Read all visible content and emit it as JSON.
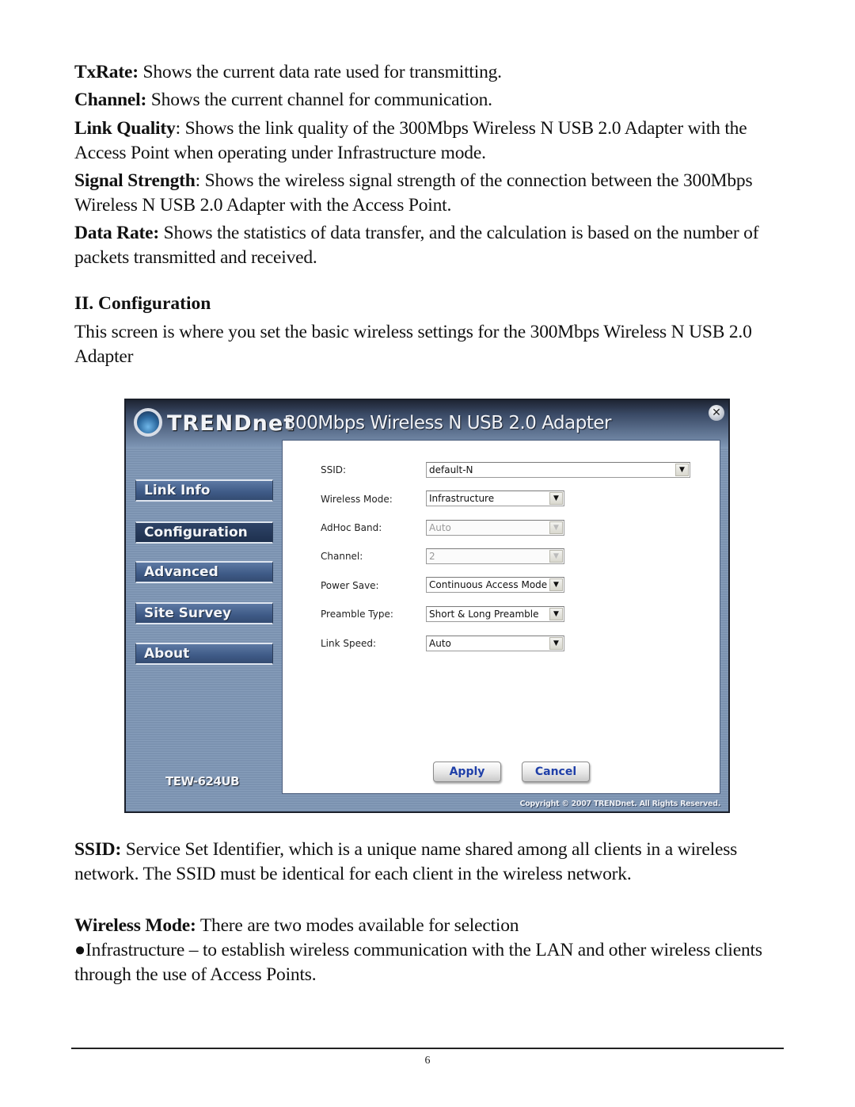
{
  "intro": [
    {
      "term": "TxRate:",
      "text": " Shows the current data rate used for transmitting."
    },
    {
      "term": "Channel:",
      "text": " Shows the current channel for communication."
    },
    {
      "term": "Link Quality",
      "text": ": Shows the link quality of the 300Mbps Wireless N USB 2.0 Adapter with the Access Point when operating under Infrastructure mode."
    },
    {
      "term": "Signal Strength",
      "text": ": Shows the wireless signal strength of the connection between the 300Mbps Wireless N USB 2.0 Adapter with the Access Point."
    },
    {
      "term": "Data Rate:",
      "text": " Shows the statistics of data transfer, and the calculation is based on the number of packets transmitted and received."
    }
  ],
  "section": {
    "heading": "II. Configuration",
    "description": "This screen is where you set the basic wireless settings for the 300Mbps Wireless N USB 2.0 Adapter"
  },
  "app": {
    "brand": "TRENDnet",
    "product_title": "300Mbps Wireless N USB 2.0 Adapter",
    "close_icon": "close-icon",
    "model": "TEW-624UB",
    "copyright": "Copyright © 2007 TRENDnet. All Rights Reserved.",
    "nav": [
      {
        "label": "Link Info",
        "active": false
      },
      {
        "label": "Configuration",
        "active": true
      },
      {
        "label": "Advanced",
        "active": false
      },
      {
        "label": "Site Survey",
        "active": false
      },
      {
        "label": "About",
        "active": false
      }
    ],
    "fields": [
      {
        "label": "SSID:",
        "value": "default-N",
        "enabled": true
      },
      {
        "label": "Wireless Mode:",
        "value": "Infrastructure",
        "enabled": true
      },
      {
        "label": "AdHoc Band:",
        "value": "Auto",
        "enabled": false
      },
      {
        "label": "Channel:",
        "value": "2",
        "enabled": false
      },
      {
        "label": "Power Save:",
        "value": "Continuous Access Mode",
        "enabled": true
      },
      {
        "label": "Preamble Type:",
        "value": "Short & Long Preamble",
        "enabled": true
      },
      {
        "label": "Link Speed:",
        "value": "Auto",
        "enabled": true
      }
    ],
    "apply_label": "Apply",
    "cancel_label": "Cancel"
  },
  "details": [
    {
      "term": "SSID:",
      "text": " Service Set Identifier, which is a unique name shared among all clients in a wireless network. The SSID must be identical for each client in the wireless network."
    },
    {
      "term": "Wireless Mode:",
      "text": " There are two modes available for selection"
    }
  ],
  "bullet": "●Infrastructure – to establish wireless communication with the LAN and other wireless clients through the use of Access Points.",
  "page_number": "6"
}
